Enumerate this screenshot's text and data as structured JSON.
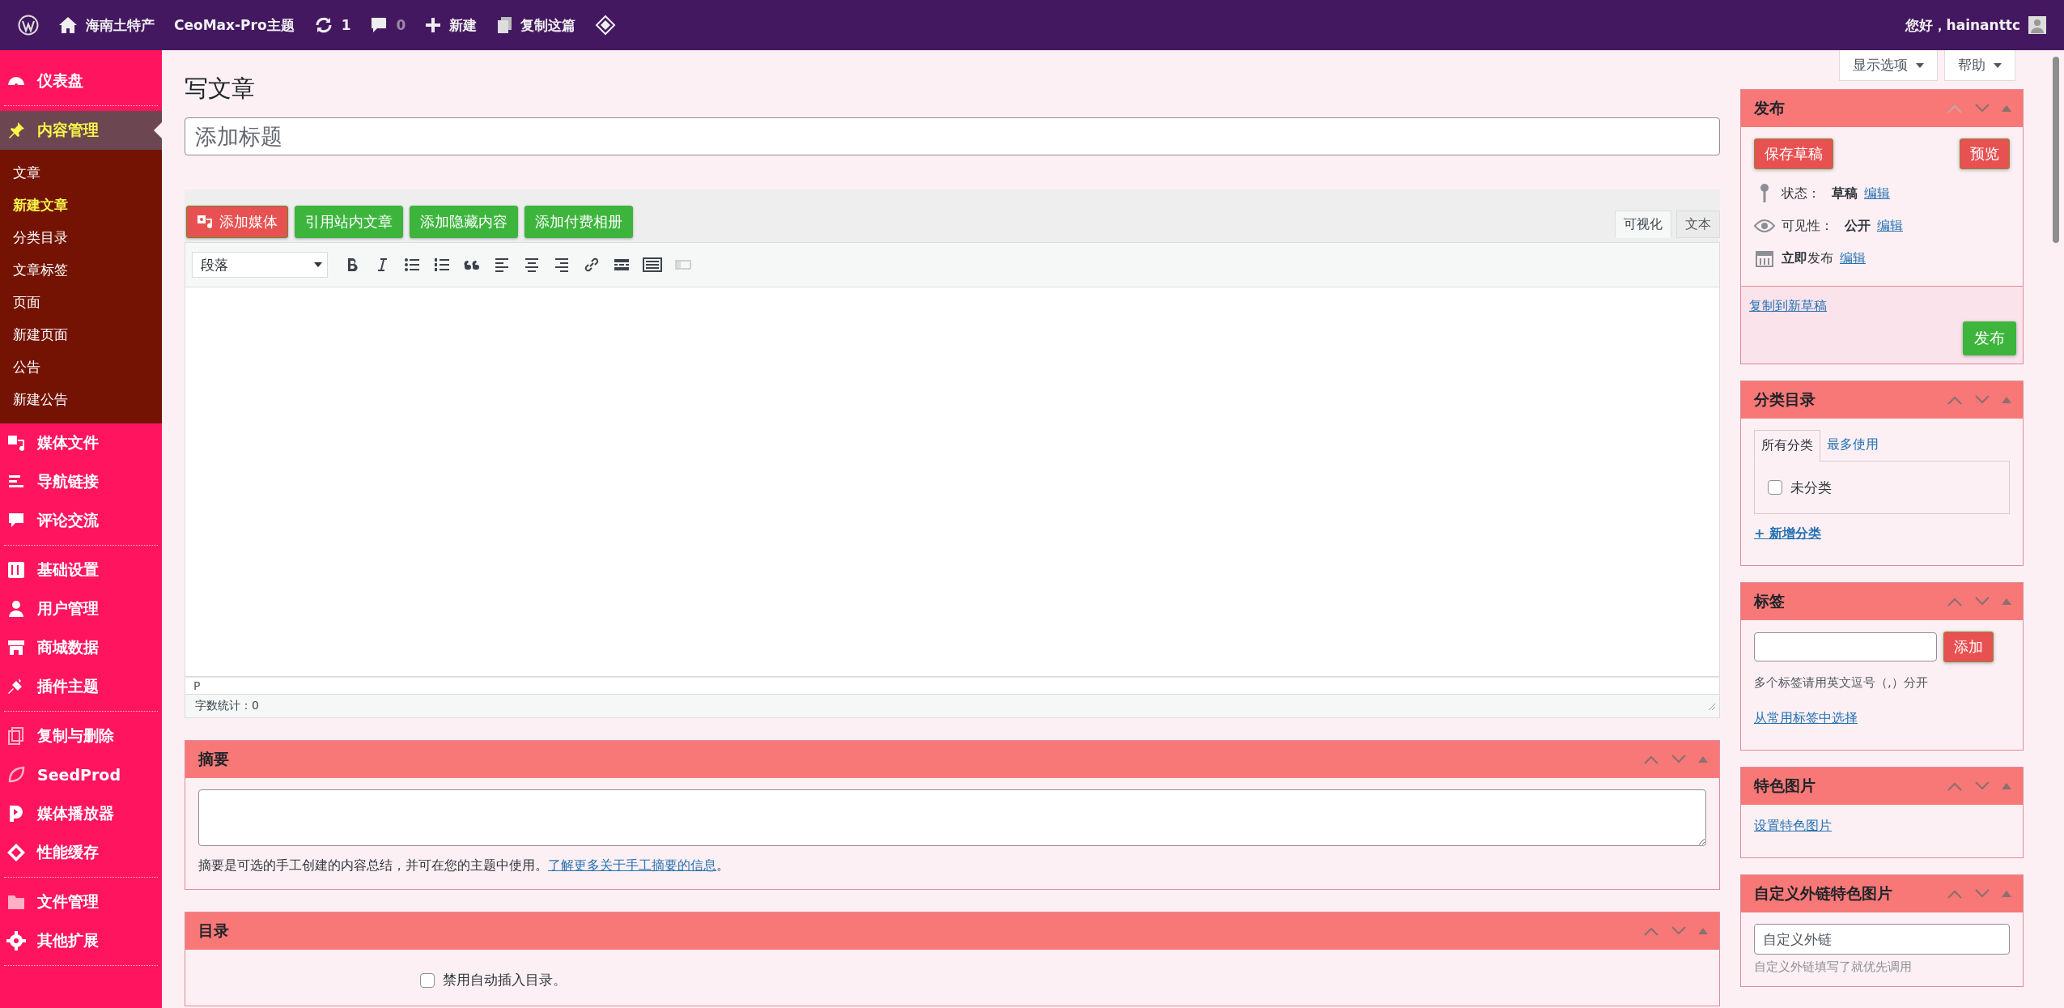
{
  "admin_bar": {
    "items": [
      {
        "kind": "logo"
      },
      {
        "kind": "home",
        "label": "海南土特产"
      },
      {
        "kind": "text",
        "label": "CeoMax-Pro主题"
      },
      {
        "kind": "updates",
        "label": "1"
      },
      {
        "kind": "comments",
        "label": "0"
      },
      {
        "kind": "new",
        "label": "新建"
      },
      {
        "kind": "copy",
        "label": "复制这篇"
      },
      {
        "kind": "diamond"
      }
    ],
    "greeting": "您好，hainanttc"
  },
  "sidebar": {
    "groups": [
      {
        "items": [
          {
            "kind": "dashboard",
            "label": "仪表盘",
            "selected": false
          }
        ]
      },
      {
        "items": [
          {
            "kind": "pin",
            "label": "内容管理",
            "selected": true,
            "children": [
              {
                "label": "文章",
                "selected": false
              },
              {
                "label": "新建文章",
                "selected": true
              },
              {
                "label": "分类目录",
                "selected": false
              },
              {
                "label": "文章标签",
                "selected": false
              },
              {
                "label": "页面",
                "selected": false
              },
              {
                "label": "新建页面",
                "selected": false
              },
              {
                "label": "公告",
                "selected": false
              },
              {
                "label": "新建公告",
                "selected": false
              }
            ]
          },
          {
            "kind": "media",
            "label": "媒体文件",
            "selected": false
          },
          {
            "kind": "lines",
            "label": "导航链接",
            "selected": false
          },
          {
            "kind": "bubble",
            "label": "评论交流",
            "selected": false
          }
        ]
      },
      {
        "items": [
          {
            "kind": "settings",
            "label": "基础设置",
            "selected": false
          },
          {
            "kind": "user",
            "label": "用户管理",
            "selected": false
          },
          {
            "kind": "store",
            "label": "商城数据",
            "selected": false
          },
          {
            "kind": "plug",
            "label": "插件主题",
            "selected": false
          }
        ]
      },
      {
        "items": [
          {
            "kind": "copy",
            "label": "复制与删除",
            "selected": false
          },
          {
            "kind": "leaf",
            "label": "SeedProd",
            "selected": false
          },
          {
            "kind": "play",
            "label": "媒体播放器",
            "selected": false
          },
          {
            "kind": "diamond",
            "label": "性能缓存",
            "selected": false
          }
        ]
      },
      {
        "items": [
          {
            "kind": "folder",
            "label": "文件管理",
            "selected": false
          },
          {
            "kind": "gear",
            "label": "其他扩展",
            "selected": false
          }
        ]
      }
    ]
  },
  "screen_buttons": [
    {
      "label": "显示选项"
    },
    {
      "label": "帮助"
    }
  ],
  "page_title": "写文章",
  "title_field": {
    "placeholder": "添加标题"
  },
  "media_buttons": [
    {
      "kind": "media",
      "label": "添加媒体"
    },
    {
      "kind": "plain",
      "label": "引用站内文章"
    },
    {
      "kind": "plain",
      "label": "添加隐藏内容"
    },
    {
      "kind": "plain",
      "label": "添加付费相册"
    }
  ],
  "editor_tabs": [
    {
      "label": "可视化",
      "selected": true
    },
    {
      "label": "文本",
      "selected": false
    }
  ],
  "format_select": {
    "value": "段落"
  },
  "path": "P",
  "word_count": "字数统计：0",
  "main_boxes": [
    {
      "kind": "excerpt",
      "title": "摘要",
      "help": "摘要是可选的手工创建的内容总结，并可在您的主题中使用。",
      "link": "了解更多关于手工摘要的信息",
      "after": "。"
    },
    {
      "kind": "toc",
      "title": "目录",
      "option": {
        "label": "禁用自动插入目录。",
        "checked": false
      }
    }
  ],
  "side_boxes": [
    {
      "kind": "publish",
      "title": "发布",
      "move_up_disabled": true,
      "save": "保存草稿",
      "preview": "预览",
      "rows": [
        {
          "kind": "pin",
          "label": "状态：",
          "value": "草稿",
          "edit": "编辑"
        },
        {
          "kind": "eye",
          "label": "可见性：",
          "value": "公开",
          "edit": "编辑"
        },
        {
          "kind": "calendar",
          "label": "",
          "value": "**立即**发布",
          "edit": "编辑"
        }
      ],
      "copy_link": "复制到新草稿",
      "publish": "发布"
    },
    {
      "kind": "categories",
      "title": "分类目录",
      "move_up_disabled": false,
      "tabs": [
        {
          "label": "所有分类",
          "selected": true
        },
        {
          "label": "最多使用",
          "selected": false
        }
      ],
      "items": [
        {
          "label": "未分类",
          "checked": false
        }
      ],
      "add_link": "+ 新增分类"
    },
    {
      "kind": "tags",
      "title": "标签",
      "move_up_disabled": false,
      "button": "添加",
      "hint": "多个标签请用英文逗号（,）分开",
      "link": "从常用标签中选择"
    },
    {
      "kind": "featured",
      "title": "特色图片",
      "move_up_disabled": false,
      "link": "设置特色图片"
    },
    {
      "kind": "external",
      "title": "自定义外链特色图片",
      "move_up_disabled": false,
      "placeholder": "自定义外链",
      "hint": "自定义外链填写了就优先调用"
    }
  ]
}
